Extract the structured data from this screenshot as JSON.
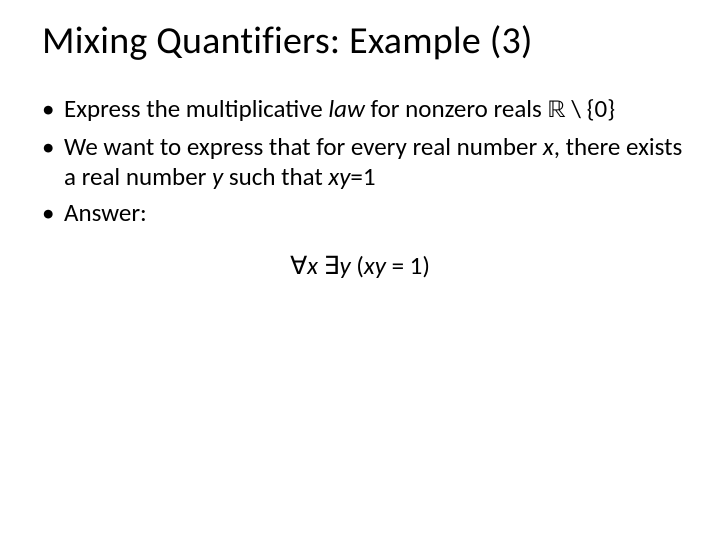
{
  "title": "Mixing Quantifiers: Example (3)",
  "bullets": {
    "b1_a": "Express the multiplicative ",
    "b1_law": "law",
    "b1_b": " for nonzero reals ",
    "b1_R": "ℝ",
    "b1_c": " \\ {0}",
    "b2_a": "We want to express that for every real number ",
    "b2_x": "x",
    "b2_b": ", there exists a real number ",
    "b2_y": "y",
    "b2_c": " such that ",
    "b2_xy": "xy",
    "b2_d": "=1",
    "b3": "Answer:"
  },
  "formula": {
    "forall": "∀",
    "x": "x ",
    "exists": "∃",
    "y": "y ",
    "open": "(",
    "xy": "xy ",
    "eq": "= 1",
    "close": ")"
  }
}
